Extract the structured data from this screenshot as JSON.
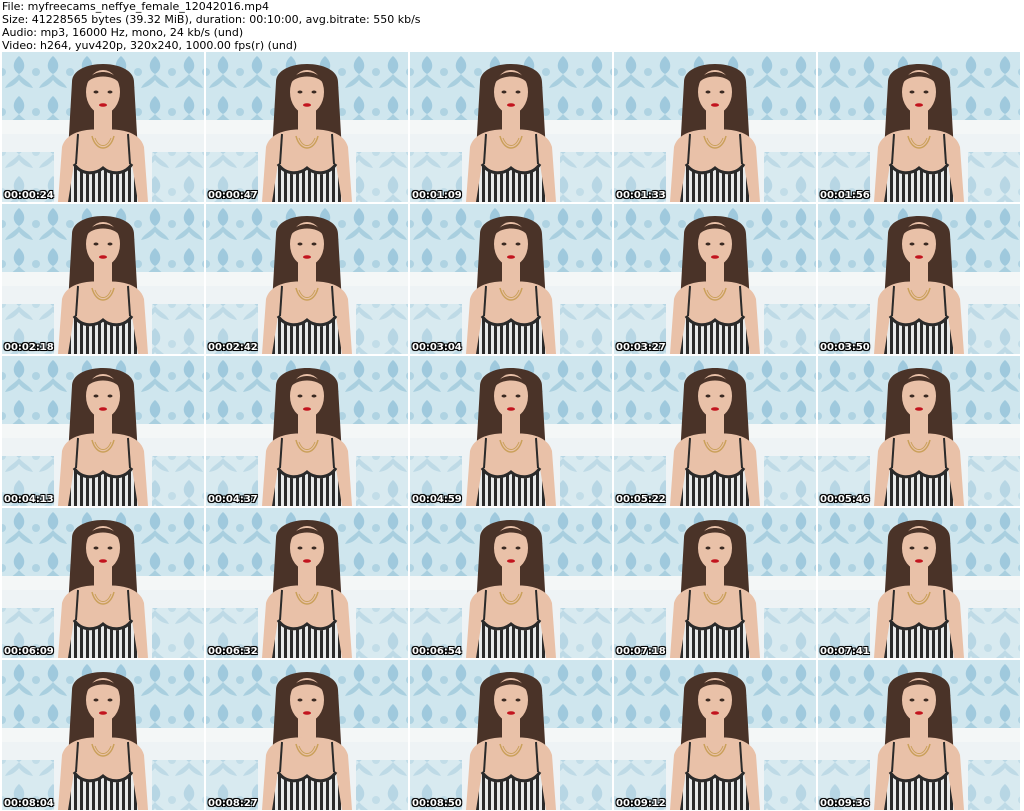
{
  "header": {
    "file_line": "File: myfreecams_neffye_female_12042016.mp4",
    "size_line": "Size: 41228565 bytes (39.32 MiB), duration: 00:10:00, avg.bitrate: 550 kb/s",
    "audio_line": "Audio: mp3, 16000 Hz, mono, 24 kb/s (und)",
    "video_line": "Video: h264, yuv420p, 320x240, 1000.00 fps(r) (und)"
  },
  "thumbnails": [
    {
      "time": "00:00:24"
    },
    {
      "time": "00:00:47"
    },
    {
      "time": "00:01:09"
    },
    {
      "time": "00:01:33"
    },
    {
      "time": "00:01:56"
    },
    {
      "time": "00:02:18"
    },
    {
      "time": "00:02:42"
    },
    {
      "time": "00:03:04"
    },
    {
      "time": "00:03:27"
    },
    {
      "time": "00:03:50"
    },
    {
      "time": "00:04:13"
    },
    {
      "time": "00:04:37"
    },
    {
      "time": "00:04:59"
    },
    {
      "time": "00:05:22"
    },
    {
      "time": "00:05:46"
    },
    {
      "time": "00:06:09"
    },
    {
      "time": "00:06:32"
    },
    {
      "time": "00:06:54"
    },
    {
      "time": "00:07:18"
    },
    {
      "time": "00:07:41"
    },
    {
      "time": "00:08:04"
    },
    {
      "time": "00:08:27"
    },
    {
      "time": "00:08:50"
    },
    {
      "time": "00:09:12"
    },
    {
      "time": "00:09:36"
    }
  ],
  "colors": {
    "wallpaper": "#cfe6ee",
    "pattern": "#8fbfd6",
    "wall_trim": "#f4f7f7",
    "hair": "#4a3328",
    "skin": "#e9c1a8",
    "dress_dark": "#2a2a2a",
    "dress_light": "#e8eaea"
  }
}
